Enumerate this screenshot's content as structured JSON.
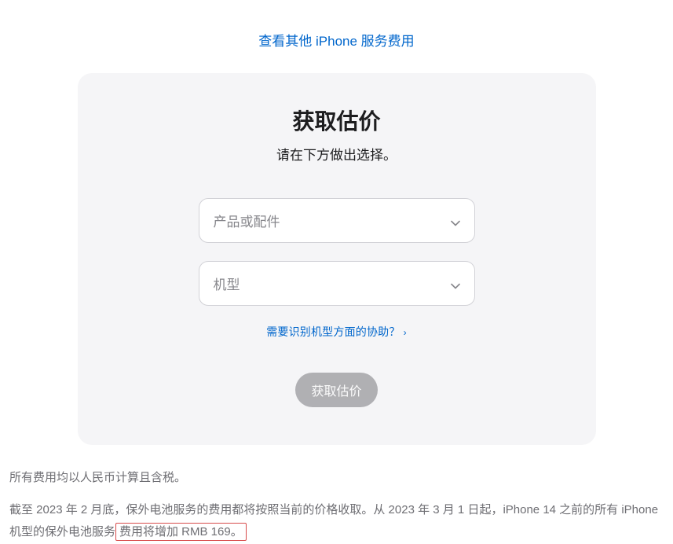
{
  "topLink": {
    "label": "查看其他 iPhone 服务费用"
  },
  "card": {
    "title": "获取估价",
    "subtitle": "请在下方做出选择。",
    "select1": {
      "placeholder": "产品或配件"
    },
    "select2": {
      "placeholder": "机型"
    },
    "helpLink": {
      "label": "需要识别机型方面的协助？"
    },
    "submit": {
      "label": "获取估价"
    }
  },
  "footer": {
    "line1": "所有费用均以人民币计算且含税。",
    "line2_part1": "截至 2023 年 2 月底，保外电池服务的费用都将按照当前的价格收取。从 2023 年 3 月 1 日起，iPhone 14 之前的所有 iPhone 机型的保外电池服务",
    "line2_highlight": "费用将增加 RMB 169。"
  }
}
